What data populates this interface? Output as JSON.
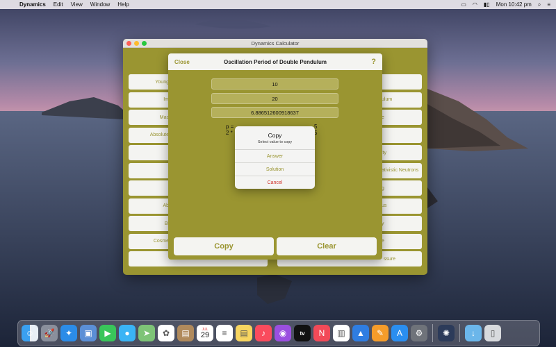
{
  "menubar": {
    "app_name": "Dynamics",
    "items": [
      "Edit",
      "View",
      "Window",
      "Help"
    ],
    "clock": "Mon 10:42 pm"
  },
  "window": {
    "title": "Dynamics Calculator",
    "left_buttons": [
      "Young",
      "Im",
      "Mac",
      "Absolute",
      "",
      "",
      "",
      "Ab",
      "Bi",
      "Cosme",
      ""
    ],
    "right_buttons": [
      "",
      "ulum",
      "e",
      "",
      "lty",
      "ativistic Neutrons",
      "g",
      "us",
      "y",
      "e",
      "ssure"
    ]
  },
  "sheet": {
    "close_label": "Close",
    "title": "Oscillation Period of Double Pendulum",
    "help_label": "?",
    "field1": "10",
    "field2": "20",
    "result": "6.886512600918637",
    "formula_line1": "p =",
    "formula_line1_right": "5",
    "formula_line2": "2 *",
    "formula_line2_right": "5",
    "copy_button": "Copy",
    "clear_button": "Clear"
  },
  "copy_dialog": {
    "title": "Copy",
    "subtitle": "Select value to copy",
    "options": [
      "Answer",
      "Solution"
    ],
    "cancel": "Cancel"
  },
  "dock": {
    "icons": [
      "finder-icon",
      "launchpad-icon",
      "safari-icon",
      "preview-icon",
      "facetime-icon",
      "messages-icon",
      "maps-icon",
      "photos-icon",
      "contacts-icon",
      "calendar-icon",
      "reminders-icon",
      "notes-icon",
      "music-icon",
      "podcasts-icon",
      "tv-icon",
      "news-icon",
      "numbers-icon",
      "keynote-icon",
      "pages-icon",
      "appstore-icon",
      "system-preferences-icon",
      "dynamics-app-icon",
      "downloads-folder-icon",
      "trash-icon"
    ],
    "calendar_day": "29",
    "calendar_month": "JUL",
    "tv_label": "tv"
  },
  "colors": {
    "accent": "#9a9531",
    "button_bg": "#f4f4f1",
    "cancel": "#d0342c"
  }
}
